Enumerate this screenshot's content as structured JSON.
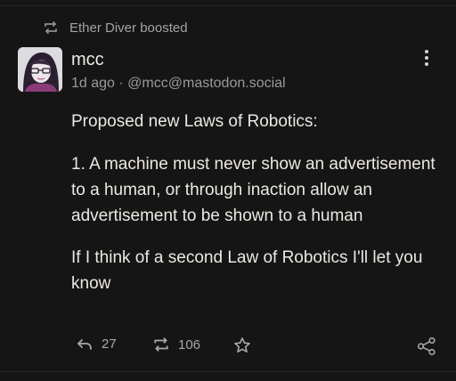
{
  "boost": {
    "text": "Ether Diver boosted",
    "icon": "boost-icon"
  },
  "post": {
    "display_name": "mcc",
    "time": "1d ago",
    "separator": "·",
    "handle": "@mcc@mastodon.social",
    "paragraphs": [
      "Proposed new Laws of Robotics:",
      "1. A machine must never show an advertisement to a human, or through inaction allow an advertisement to be shown to a human",
      "If I think of a second Law of Robotics I'll let you know"
    ]
  },
  "actions": {
    "reply_count": "27",
    "boost_count": "106",
    "icons": [
      "reply-icon",
      "boost-icon",
      "favourite-star-icon",
      "share-icon",
      "more-options-icon"
    ]
  },
  "colors": {
    "background": "#151515",
    "text": "#ece8e2",
    "muted": "#9a9a9a"
  }
}
